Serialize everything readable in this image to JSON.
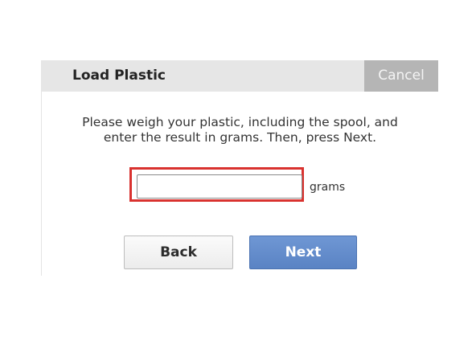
{
  "dialog": {
    "title": "Load Plastic",
    "cancel_label": "Cancel",
    "instructions": "Please weigh your plastic, including the spool, and enter the result in grams. Then, press Next.",
    "weight_input": {
      "value": "",
      "placeholder": ""
    },
    "unit_label": "grams",
    "back_label": "Back",
    "next_label": "Next"
  },
  "colors": {
    "header_bg": "#e6e6e6",
    "cancel_bg": "#b5b5b5",
    "next_bg": "#5f8acb",
    "highlight": "#d9322f"
  }
}
